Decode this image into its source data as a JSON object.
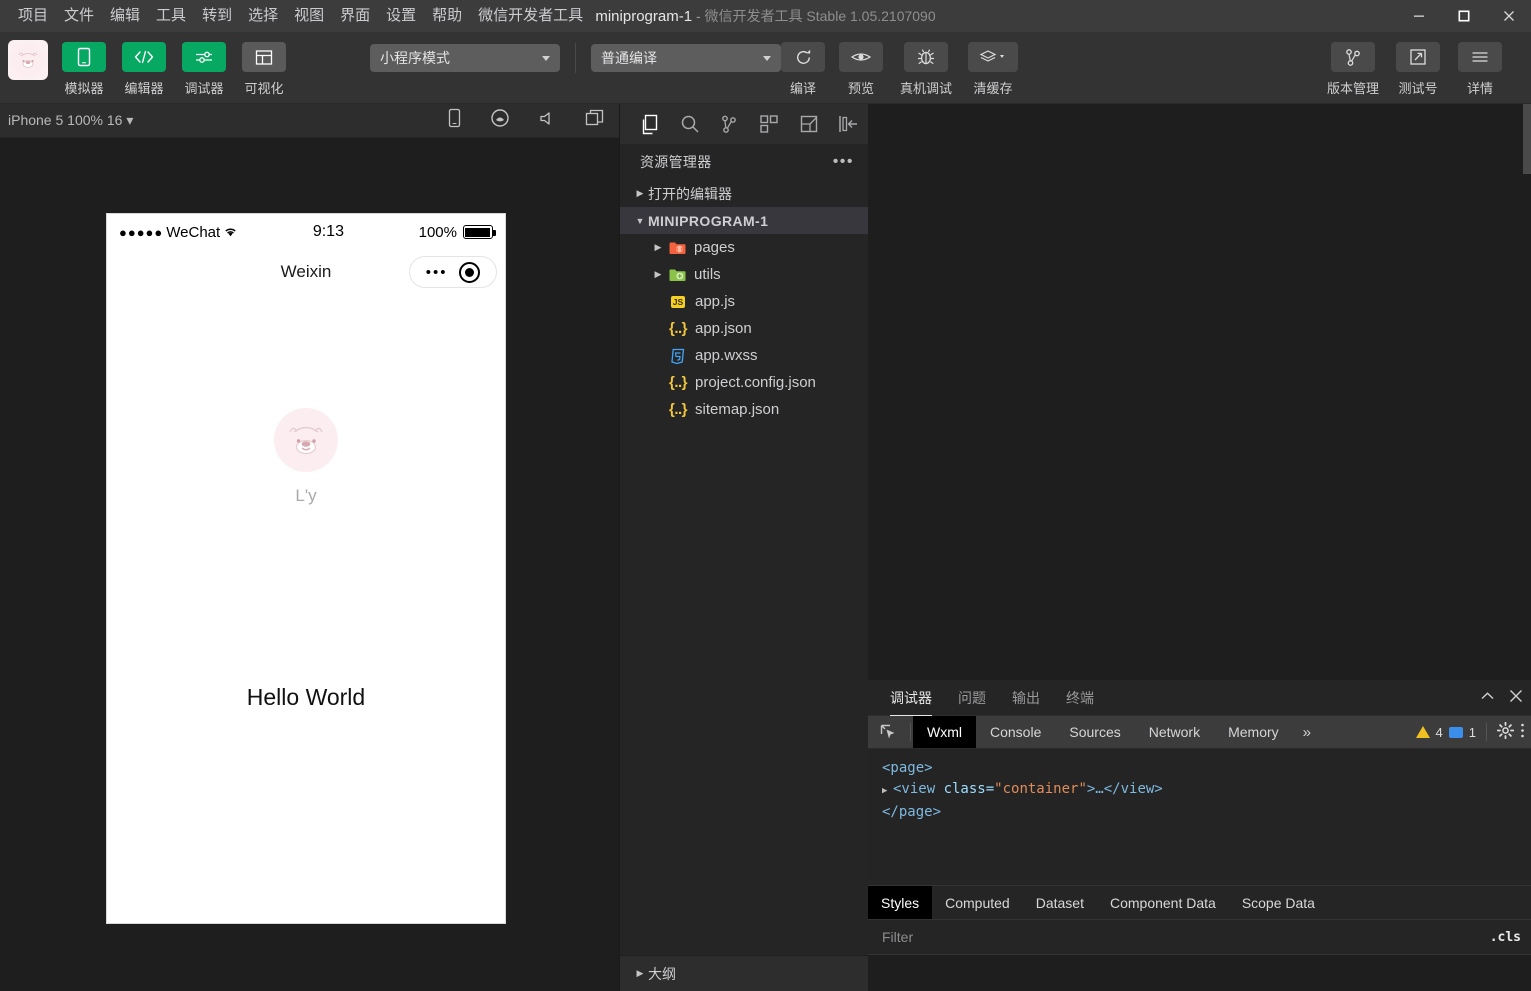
{
  "titlebar": {
    "menus": [
      "项目",
      "文件",
      "编辑",
      "工具",
      "转到",
      "选择",
      "视图",
      "界面",
      "设置",
      "帮助",
      "微信开发者工具"
    ],
    "project_name": "miniprogram-1",
    "dash": "-",
    "app_name": "微信开发者工具",
    "version": "Stable 1.05.2107090",
    "window_controls": [
      "minimize-button",
      "maximize-button",
      "close-button"
    ]
  },
  "toolbar": {
    "avatar_icon": "bear-avatar-icon",
    "left_buttons": [
      {
        "label": "模拟器",
        "icon": "phone-icon",
        "style": "green"
      },
      {
        "label": "编辑器",
        "icon": "code-icon",
        "style": "green"
      },
      {
        "label": "调试器",
        "icon": "sliders-icon",
        "style": "green"
      },
      {
        "label": "可视化",
        "icon": "layout-icon",
        "style": "gray"
      }
    ],
    "mode_select": "小程序模式",
    "compile_select": "普通编译",
    "center_buttons": [
      {
        "label": "编译",
        "icon": "refresh-icon"
      },
      {
        "label": "预览",
        "icon": "eye-icon"
      },
      {
        "label": "真机调试",
        "icon": "bug-icon"
      },
      {
        "label": "清缓存",
        "icon": "layers-icon",
        "has_caret": true
      }
    ],
    "right_buttons": [
      {
        "label": "版本管理",
        "icon": "branch-icon"
      },
      {
        "label": "测试号",
        "icon": "external-link-icon"
      },
      {
        "label": "详情",
        "icon": "hamburger-icon"
      }
    ]
  },
  "simulator": {
    "device_label": "iPhone 5 100% 16",
    "device_caret": "▾",
    "bar_icons": [
      "phone-outline-icon",
      "record-icon",
      "sound-icon",
      "multi-window-icon"
    ],
    "phone": {
      "status_dots": "●●●●●",
      "carrier": "WeChat",
      "wifi_icon": "wifi-icon",
      "time": "9:13",
      "battery_text": "100%",
      "battery_icon": "battery-full-icon",
      "nav_title": "Weixin",
      "capsule_dots": "•••",
      "capsule_target_icon": "target-icon",
      "user_avatar_icon": "bear-avatar-icon",
      "user_name": "L'y",
      "body_text": "Hello World"
    }
  },
  "explorer": {
    "activity_icons": [
      "files-icon",
      "search-icon",
      "source-control-icon",
      "extensions-icon",
      "wxml-panel-icon",
      "collapse-sidebar-icon"
    ],
    "title": "资源管理器",
    "more_actions": "•••",
    "sections": [
      {
        "label": "打开的编辑器",
        "expanded": false
      },
      {
        "label": "MINIPROGRAM-1",
        "expanded": true
      }
    ],
    "files": [
      {
        "name": "pages",
        "type": "folder",
        "icon": "folder-pages-icon",
        "expandable": true
      },
      {
        "name": "utils",
        "type": "folder",
        "icon": "folder-utils-icon",
        "expandable": true
      },
      {
        "name": "app.js",
        "type": "js",
        "icon": "js-file-icon",
        "expandable": false
      },
      {
        "name": "app.json",
        "type": "json",
        "icon": "json-file-icon",
        "expandable": false
      },
      {
        "name": "app.wxss",
        "type": "wxss",
        "icon": "wxss-file-icon",
        "expandable": false
      },
      {
        "name": "project.config.json",
        "type": "json",
        "icon": "json-file-icon",
        "expandable": false
      },
      {
        "name": "sitemap.json",
        "type": "json",
        "icon": "json-file-icon",
        "expandable": false
      }
    ],
    "outline_label": "大纲"
  },
  "panel": {
    "tabs": [
      {
        "label": "调试器",
        "active": true
      },
      {
        "label": "问题",
        "active": false
      },
      {
        "label": "输出",
        "active": false
      },
      {
        "label": "终端",
        "active": false
      }
    ],
    "controls": [
      "chevron-up-icon",
      "close-icon"
    ],
    "devtools_tabs": [
      {
        "label": "Wxml",
        "active": true
      },
      {
        "label": "Console",
        "active": false
      },
      {
        "label": "Sources",
        "active": false
      },
      {
        "label": "Network",
        "active": false
      },
      {
        "label": "Memory",
        "active": false
      }
    ],
    "overflow": "»",
    "warning_count": "4",
    "message_count": "1",
    "right_icons": [
      "inspect-element-icon",
      "settings-gear-icon",
      "more-vertical-icon"
    ],
    "wxml": {
      "line1": "<page>",
      "line2_tag_open": "<view ",
      "line2_attr": "class=",
      "line2_value": "\"container\"",
      "line2_rest": ">…</view>",
      "line3": "</page>"
    },
    "styles_tabs": [
      {
        "label": "Styles",
        "active": true
      },
      {
        "label": "Computed",
        "active": false
      },
      {
        "label": "Dataset",
        "active": false
      },
      {
        "label": "Component Data",
        "active": false
      },
      {
        "label": "Scope Data",
        "active": false
      }
    ],
    "filter_placeholder": "Filter",
    "cls_button": ".cls"
  },
  "colors": {
    "accent_green": "#07a862",
    "titlebar": "#3c3c3c",
    "toolbar": "#333333",
    "sidebar": "#252526",
    "editor": "#1e1e1e",
    "warning": "#f0c020",
    "info": "#3b8eea"
  }
}
